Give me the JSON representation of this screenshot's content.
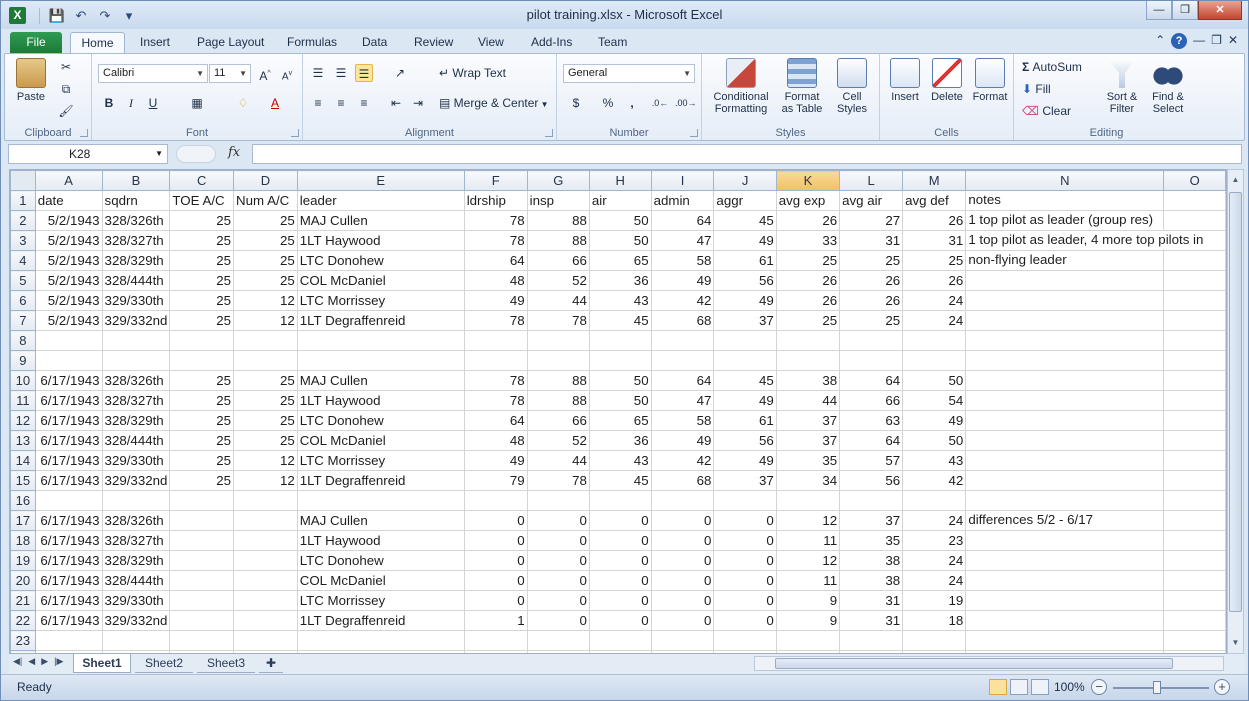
{
  "window": {
    "title": "pilot training.xlsx  -  Microsoft Excel",
    "app_icon": "X"
  },
  "menu_tabs": [
    "File",
    "Home",
    "Insert",
    "Page Layout",
    "Formulas",
    "Data",
    "Review",
    "View",
    "Add-Ins",
    "Team"
  ],
  "ribbon": {
    "clipboard": {
      "label": "Clipboard",
      "paste": "Paste"
    },
    "font": {
      "label": "Font",
      "name": "Calibri",
      "size": "11",
      "bold": "B",
      "italic": "I",
      "underline": "U"
    },
    "alignment": {
      "label": "Alignment",
      "wrap_text": "Wrap Text",
      "merge_center": "Merge & Center"
    },
    "number": {
      "label": "Number",
      "format": "General",
      "currency": "$",
      "percent": "%",
      "comma": ","
    },
    "styles": {
      "label": "Styles",
      "conditional": "Conditional\nFormatting",
      "conditional_l1": "Conditional",
      "conditional_l2": "Formatting",
      "format_table_l1": "Format",
      "format_table_l2": "as Table",
      "cell_styles_l1": "Cell",
      "cell_styles_l2": "Styles"
    },
    "cells": {
      "label": "Cells",
      "insert": "Insert",
      "delete": "Delete",
      "format": "Format"
    },
    "editing": {
      "label": "Editing",
      "autosum": "AutoSum",
      "fill": "Fill",
      "clear": "Clear",
      "sort_l1": "Sort &",
      "sort_l2": "Filter",
      "find_l1": "Find &",
      "find_l2": "Select"
    }
  },
  "formula_bar": {
    "name_box": "K28",
    "fx": "fx",
    "formula": ""
  },
  "columns": [
    "A",
    "B",
    "C",
    "D",
    "E",
    "F",
    "G",
    "H",
    "I",
    "J",
    "K",
    "L",
    "M",
    "N",
    "O"
  ],
  "selected_column": "K",
  "rows": [
    {
      "n": "1",
      "c": [
        "date",
        "sqdrn",
        "TOE A/C",
        "Num A/C",
        "leader",
        "ldrship",
        "insp",
        "air",
        "admin",
        "aggr",
        "avg exp",
        "avg air",
        "avg def",
        "notes"
      ]
    },
    {
      "n": "2",
      "c": [
        "5/2/1943",
        "328/326th",
        "25",
        "25",
        "MAJ Cullen",
        "78",
        "88",
        "50",
        "64",
        "45",
        "26",
        "27",
        "26",
        "1 top pilot as leader (group res)"
      ]
    },
    {
      "n": "3",
      "c": [
        "5/2/1943",
        "328/327th",
        "25",
        "25",
        "1LT Haywood",
        "78",
        "88",
        "50",
        "47",
        "49",
        "33",
        "31",
        "31",
        "1 top pilot as leader, 4 more top pilots in"
      ]
    },
    {
      "n": "4",
      "c": [
        "5/2/1943",
        "328/329th",
        "25",
        "25",
        "LTC Donohew",
        "64",
        "66",
        "65",
        "58",
        "61",
        "25",
        "25",
        "25",
        "non-flying leader"
      ]
    },
    {
      "n": "5",
      "c": [
        "5/2/1943",
        "328/444th",
        "25",
        "25",
        "COL McDaniel",
        "48",
        "52",
        "36",
        "49",
        "56",
        "26",
        "26",
        "26",
        ""
      ]
    },
    {
      "n": "6",
      "c": [
        "5/2/1943",
        "329/330th",
        "25",
        "12",
        "LTC Morrissey",
        "49",
        "44",
        "43",
        "42",
        "49",
        "26",
        "26",
        "24",
        ""
      ]
    },
    {
      "n": "7",
      "c": [
        "5/2/1943",
        "329/332nd",
        "25",
        "12",
        "1LT Degraffenreid",
        "78",
        "78",
        "45",
        "68",
        "37",
        "25",
        "25",
        "24",
        ""
      ]
    },
    {
      "n": "8",
      "c": [
        "",
        "",
        "",
        "",
        "",
        "",
        "",
        "",
        "",
        "",
        "",
        "",
        "",
        ""
      ]
    },
    {
      "n": "9",
      "c": [
        "",
        "",
        "",
        "",
        "",
        "",
        "",
        "",
        "",
        "",
        "",
        "",
        "",
        ""
      ]
    },
    {
      "n": "10",
      "c": [
        "6/17/1943",
        "328/326th",
        "25",
        "25",
        "MAJ Cullen",
        "78",
        "88",
        "50",
        "64",
        "45",
        "38",
        "64",
        "50",
        ""
      ]
    },
    {
      "n": "11",
      "c": [
        "6/17/1943",
        "328/327th",
        "25",
        "25",
        "1LT Haywood",
        "78",
        "88",
        "50",
        "47",
        "49",
        "44",
        "66",
        "54",
        ""
      ]
    },
    {
      "n": "12",
      "c": [
        "6/17/1943",
        "328/329th",
        "25",
        "25",
        "LTC Donohew",
        "64",
        "66",
        "65",
        "58",
        "61",
        "37",
        "63",
        "49",
        ""
      ]
    },
    {
      "n": "13",
      "c": [
        "6/17/1943",
        "328/444th",
        "25",
        "25",
        "COL McDaniel",
        "48",
        "52",
        "36",
        "49",
        "56",
        "37",
        "64",
        "50",
        ""
      ]
    },
    {
      "n": "14",
      "c": [
        "6/17/1943",
        "329/330th",
        "25",
        "12",
        "LTC Morrissey",
        "49",
        "44",
        "43",
        "42",
        "49",
        "35",
        "57",
        "43",
        ""
      ]
    },
    {
      "n": "15",
      "c": [
        "6/17/1943",
        "329/332nd",
        "25",
        "12",
        "1LT Degraffenreid",
        "79",
        "78",
        "45",
        "68",
        "37",
        "34",
        "56",
        "42",
        ""
      ]
    },
    {
      "n": "16",
      "c": [
        "",
        "",
        "",
        "",
        "",
        "",
        "",
        "",
        "",
        "",
        "",
        "",
        "",
        ""
      ]
    },
    {
      "n": "17",
      "c": [
        "6/17/1943",
        "328/326th",
        "",
        "",
        "MAJ Cullen",
        "0",
        "0",
        "0",
        "0",
        "0",
        "12",
        "37",
        "24",
        "differences 5/2 - 6/17"
      ]
    },
    {
      "n": "18",
      "c": [
        "6/17/1943",
        "328/327th",
        "",
        "",
        "1LT Haywood",
        "0",
        "0",
        "0",
        "0",
        "0",
        "11",
        "35",
        "23",
        ""
      ]
    },
    {
      "n": "19",
      "c": [
        "6/17/1943",
        "328/329th",
        "",
        "",
        "LTC Donohew",
        "0",
        "0",
        "0",
        "0",
        "0",
        "12",
        "38",
        "24",
        ""
      ]
    },
    {
      "n": "20",
      "c": [
        "6/17/1943",
        "328/444th",
        "",
        "",
        "COL McDaniel",
        "0",
        "0",
        "0",
        "0",
        "0",
        "11",
        "38",
        "24",
        ""
      ]
    },
    {
      "n": "21",
      "c": [
        "6/17/1943",
        "329/330th",
        "",
        "",
        "LTC Morrissey",
        "0",
        "0",
        "0",
        "0",
        "0",
        "9",
        "31",
        "19",
        ""
      ]
    },
    {
      "n": "22",
      "c": [
        "6/17/1943",
        "329/332nd",
        "",
        "",
        "1LT Degraffenreid",
        "1",
        "0",
        "0",
        "0",
        "0",
        "9",
        "31",
        "18",
        ""
      ]
    },
    {
      "n": "23",
      "c": [
        "",
        "",
        "",
        "",
        "",
        "",
        "",
        "",
        "",
        "",
        "",
        "",
        "",
        ""
      ]
    },
    {
      "n": "24",
      "c": [
        "",
        "",
        "",
        "",
        "",
        "",
        "",
        "",
        "",
        "",
        "",
        "",
        "",
        ""
      ]
    }
  ],
  "sheet_tabs": [
    "Sheet1",
    "Sheet2",
    "Sheet3"
  ],
  "active_sheet": "Sheet1",
  "status": {
    "text": "Ready",
    "zoom": "100%"
  },
  "colors": {
    "excel_green": "#1f7a3a",
    "selection_header": "#f1c15f",
    "ribbon_bg": "#e5edf7"
  }
}
